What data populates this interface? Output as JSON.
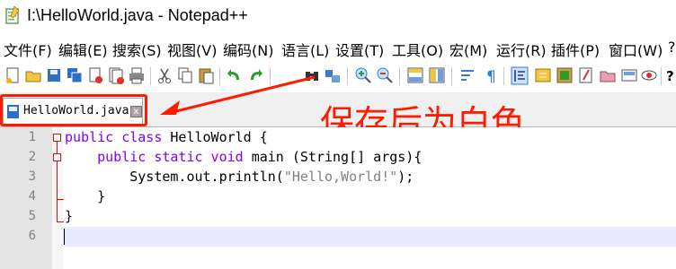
{
  "window": {
    "title": "I:\\HelloWorld.java - Notepad++"
  },
  "menu": [
    "文件(F)",
    "编辑(E)",
    "搜索(S)",
    "视图(V)",
    "编码(N)",
    "语言(L)",
    "设置(T)",
    "工具(O)",
    "宏(M)",
    "运行(R)",
    "插件(P)",
    "窗口(W)",
    "?"
  ],
  "toolbar": {
    "icons": [
      "new-file-icon",
      "open-file-icon",
      "save-icon",
      "save-all-icon",
      "close-icon",
      "close-all-icon",
      "print-icon",
      "cut-icon",
      "copy-icon",
      "paste-icon",
      "undo-icon",
      "redo-icon",
      "find-icon",
      "replace-icon",
      "zoom-in-icon",
      "zoom-out-icon",
      "sync-vertical-icon",
      "sync-horizontal-icon",
      "word-wrap-icon",
      "show-all-chars-icon",
      "indent-guide-icon",
      "doc-map-icon",
      "function-list-icon",
      "folder-workspace-icon",
      "macro-icon",
      "record-icon",
      "view-icon",
      "help-icon"
    ]
  },
  "tab": {
    "label": "HelloWorld.java",
    "close": "x"
  },
  "annotation": {
    "text": "保存后为白色",
    "color": "#ff1a00"
  },
  "editor": {
    "line_numbers": [
      "1",
      "2",
      "3",
      "4",
      "5",
      "6"
    ],
    "lines": [
      {
        "kw": "public class",
        "rest": " HelloWorld {"
      },
      {
        "pre": "    ",
        "kw": "public static void",
        "rest": " main (String[] args){"
      },
      {
        "pre": "        ",
        "text": "System.out.println(",
        "str": "\"Hello,World!\"",
        "post": ");"
      },
      {
        "text": "    }"
      },
      {
        "text": "}"
      },
      {
        "text": ""
      }
    ]
  }
}
